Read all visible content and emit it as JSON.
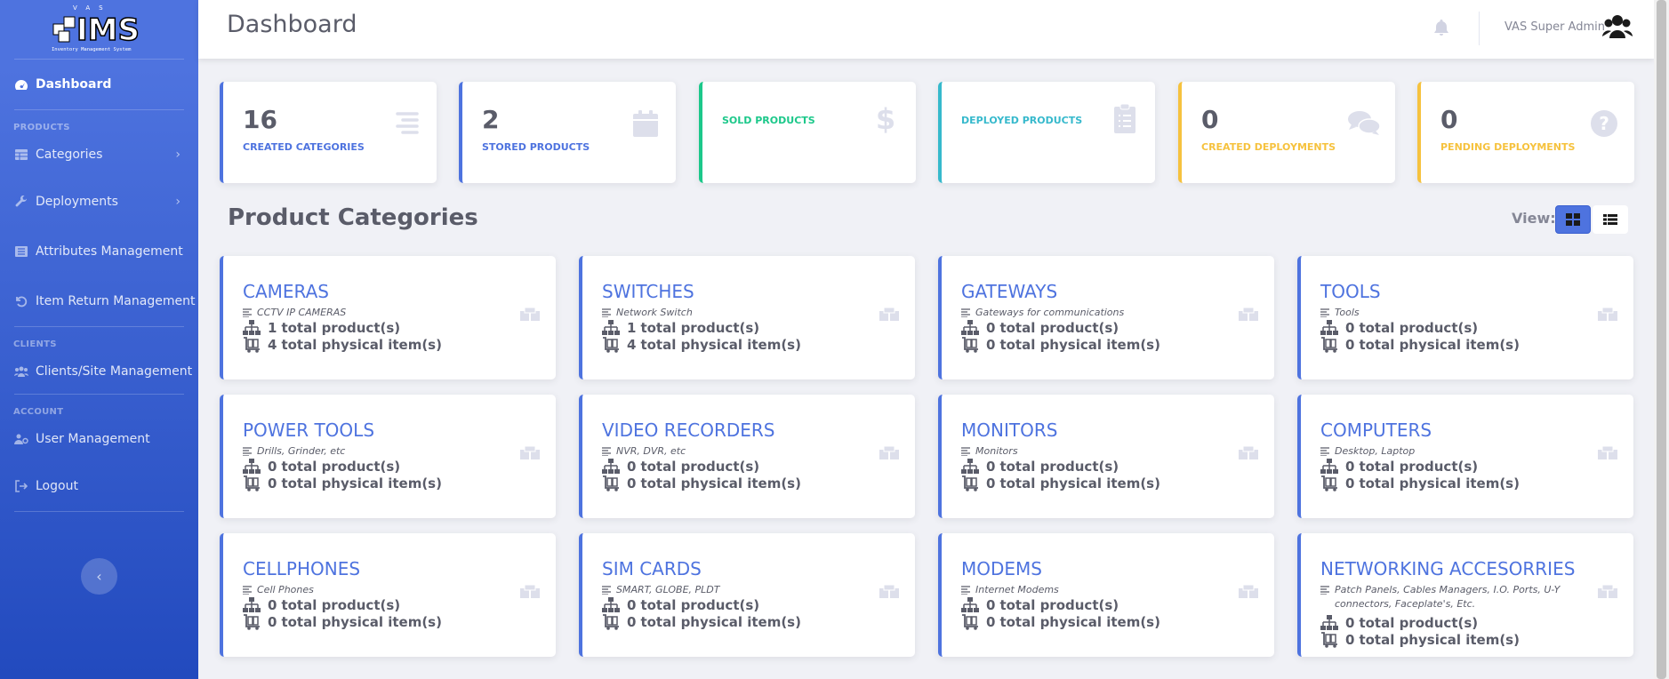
{
  "brand": {
    "name": "IMS",
    "tagline": "Inventory Management System",
    "company": "VAS"
  },
  "sidebar": {
    "dashboard": "Dashboard",
    "sections": [
      {
        "heading": "PRODUCTS"
      },
      {
        "heading": "CLIENTS"
      },
      {
        "heading": "ACCOUNT"
      }
    ],
    "items": {
      "categories": "Categories",
      "deployments": "Deployments",
      "attributes": "Attributes Management",
      "item_return": "Item Return Management",
      "clients": "Clients/Site Management",
      "users": "User Management",
      "logout": "Logout"
    },
    "toggle_icon": "chevron-left-icon"
  },
  "topbar": {
    "title": "Dashboard",
    "user_name": "VAS Super Admin"
  },
  "stats": [
    {
      "value": "16",
      "label": "CREATED CATEGORIES",
      "color": "#4e73df",
      "icon": "list-icon"
    },
    {
      "value": "2",
      "label": "STORED PRODUCTS",
      "color": "#4e73df",
      "icon": "calendar-icon"
    },
    {
      "value": "",
      "label": "SOLD PRODUCTS",
      "color": "#1cc88a",
      "icon": "dollar-icon"
    },
    {
      "value": "",
      "label": "DEPLOYED PRODUCTS",
      "color": "#36b9cc",
      "icon": "clipboard-icon"
    },
    {
      "value": "0",
      "label": "CREATED DEPLOYMENTS",
      "color": "#f6c23e",
      "icon": "comments-icon"
    },
    {
      "value": "0",
      "label": "PENDING DEPLOYMENTS",
      "color": "#f6c23e",
      "icon": "question-icon"
    }
  ],
  "categories_section": {
    "title": "Product Categories",
    "view_label": "View:"
  },
  "categories": [
    {
      "name": "CAMERAS",
      "desc": "CCTV IP CAMERAS",
      "products": "1",
      "products_label": "total product(s)",
      "items": "4",
      "items_label": "total physical item(s)"
    },
    {
      "name": "SWITCHES",
      "desc": "Network Switch",
      "products": "1",
      "products_label": "total product(s)",
      "items": "4",
      "items_label": "total physical item(s)"
    },
    {
      "name": "GATEWAYS",
      "desc": "Gateways for communications",
      "products": "0",
      "products_label": "total product(s)",
      "items": "0",
      "items_label": "total physical item(s)"
    },
    {
      "name": "TOOLS",
      "desc": "Tools",
      "products": "0",
      "products_label": "total product(s)",
      "items": "0",
      "items_label": "total physical item(s)"
    },
    {
      "name": "POWER TOOLS",
      "desc": "Drills, Grinder, etc",
      "products": "0",
      "products_label": "total product(s)",
      "items": "0",
      "items_label": "total physical item(s)"
    },
    {
      "name": "VIDEO RECORDERS",
      "desc": "NVR, DVR, etc",
      "products": "0",
      "products_label": "total product(s)",
      "items": "0",
      "items_label": "total physical item(s)"
    },
    {
      "name": "MONITORS",
      "desc": "Monitors",
      "products": "0",
      "products_label": "total product(s)",
      "items": "0",
      "items_label": "total physical item(s)"
    },
    {
      "name": "COMPUTERS",
      "desc": "Desktop, Laptop",
      "products": "0",
      "products_label": "total product(s)",
      "items": "0",
      "items_label": "total physical item(s)"
    },
    {
      "name": "CELLPHONES",
      "desc": "Cell Phones",
      "products": "0",
      "products_label": "total product(s)",
      "items": "0",
      "items_label": "total physical item(s)"
    },
    {
      "name": "SIM CARDS",
      "desc": "SMART, GLOBE, PLDT",
      "products": "0",
      "products_label": "total product(s)",
      "items": "0",
      "items_label": "total physical item(s)"
    },
    {
      "name": "MODEMS",
      "desc": "Internet Modems",
      "products": "0",
      "products_label": "total product(s)",
      "items": "0",
      "items_label": "total physical item(s)"
    },
    {
      "name": "NETWORKING ACCESORRIES",
      "desc": "Patch Panels, Cables Managers, I.O. Ports, U-Y connectors, Faceplate's, Etc.",
      "products": "0",
      "products_label": "total product(s)",
      "items": "0",
      "items_label": "total physical item(s)"
    }
  ]
}
